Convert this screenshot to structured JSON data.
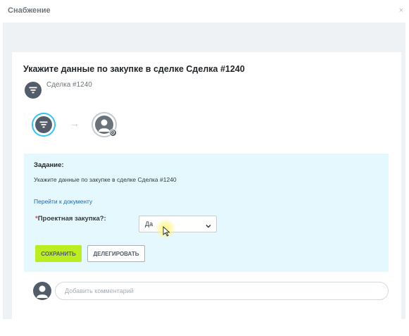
{
  "window": {
    "title": "Снабжение",
    "close_glyph": "×"
  },
  "panel": {
    "heading": "Укажите данные по закупке в сделке Сделка #1240",
    "deal_name": "Сделка #1240",
    "deal_icon": "filter-icon",
    "steps": [
      {
        "icon": "filter-icon",
        "state": "active",
        "ring_color": "#2fc6f6"
      },
      {
        "icon": "user-icon",
        "state": "pending",
        "badge": "clock-icon"
      }
    ],
    "arrow_glyph": "→"
  },
  "task": {
    "label": "Задание:",
    "description": "Укажите данные по закупке в сделке Сделка #1240",
    "doc_link": "Перейти к документу",
    "field": {
      "required_mark": "*",
      "label": "Проектная закупка?:",
      "value": "Да"
    },
    "buttons": {
      "save": "СОХРАНИТЬ",
      "delegate": "ДЕЛЕГИРОВАТЬ"
    }
  },
  "comment": {
    "placeholder": "Добавить комментарий"
  },
  "colors": {
    "accent_blue": "#2fc6f6",
    "task_bg": "#e5f8fd",
    "save_green": "#bbed21",
    "link_blue": "#2067b0",
    "icon_gray": "#535c69"
  }
}
